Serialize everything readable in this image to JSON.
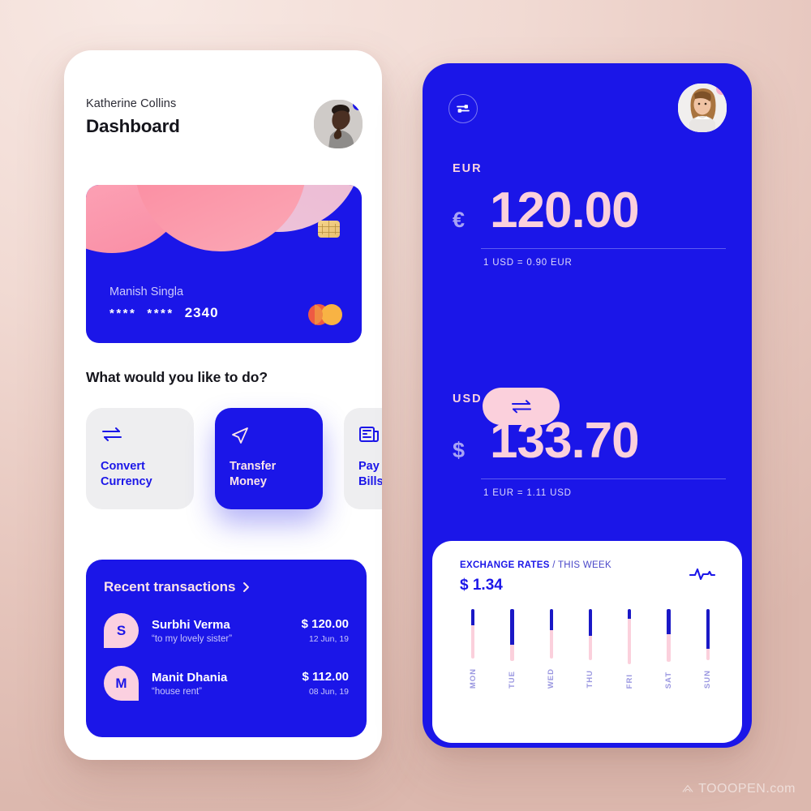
{
  "background": {
    "color_top": "#f8e9e4",
    "color_bottom": "#dcb8ae"
  },
  "brand": {
    "blue": "#1b16e8",
    "pink": "#fbd0dc",
    "light_pink": "#fbd0e0",
    "gold": "#f0c877"
  },
  "left_screen": {
    "header": {
      "user_name": "Katherine Collins",
      "title": "Dashboard",
      "avatar_icon": "user-avatar",
      "notification_dot": "blue"
    },
    "credit_card": {
      "holder": "Manish Singla",
      "mask_group_1": "****",
      "mask_group_2": "****",
      "last_four": "2340",
      "chip_icon": "emv-chip-icon",
      "network_icon": "mastercard-logo"
    },
    "prompt": "What would you like to do?",
    "actions": [
      {
        "label_line1": "Convert",
        "label_line2": "Currency",
        "icon": "swap-horizontal-icon",
        "active": false
      },
      {
        "label_line1": "Transfer",
        "label_line2": "Money",
        "icon": "send-paper-plane-icon",
        "active": true
      },
      {
        "label_line1": "Pay",
        "label_line2": "Bills",
        "icon": "bill-receipt-icon",
        "active": false
      }
    ],
    "transactions": {
      "heading": "Recent transactions",
      "chevron_icon": "chevron-right-icon",
      "items": [
        {
          "initial": "S",
          "name": "Surbhi Verma",
          "note": "“to my lovely sister”",
          "amount": "$ 120.00",
          "date": "12 Jun, 19"
        },
        {
          "initial": "M",
          "name": "Manit Dhania",
          "note": "“house rent”",
          "amount": "$ 112.00",
          "date": "08 Jun, 19"
        }
      ]
    }
  },
  "right_screen": {
    "settings_icon": "sliders-settings-icon",
    "avatar_icon": "user-avatar",
    "notification_dot": "pink",
    "from": {
      "code": "EUR",
      "symbol": "€",
      "amount": "120.00",
      "rate": "1 USD = 0.90 EUR"
    },
    "to": {
      "code": "USD",
      "symbol": "$",
      "amount": "133.70",
      "rate": "1 EUR = 1.11 USD"
    },
    "swap_button_icon": "swap-horizontal-icon",
    "chart_card": {
      "title_bold": "EXCHANGE RATES",
      "title_light": "/ THIS WEEK",
      "value": "$ 1.34",
      "trend_icon": "pulse-activity-icon"
    }
  },
  "chart_data": {
    "type": "bar",
    "title": "EXCHANGE RATES / THIS WEEK",
    "subtitle": "$ 1.34",
    "categories": [
      "MON",
      "TUE",
      "WED",
      "THU",
      "FRI",
      "SAT",
      "SUN"
    ],
    "series": [
      {
        "name": "blue-segment-pct",
        "values": [
          33,
          68,
          43,
          52,
          18,
          48,
          78
        ]
      },
      {
        "name": "pink-segment-pct",
        "values": [
          67,
          32,
          57,
          48,
          82,
          52,
          22
        ]
      }
    ],
    "ylabel": "",
    "xlabel": "",
    "ylim": [
      0,
      100
    ],
    "grid": false,
    "legend": "none",
    "colors": {
      "blue-segment-pct": "#1a18c6",
      "pink-segment-pct": "#fbd0dc"
    }
  },
  "watermark": {
    "text": "TOOOPEN.com",
    "icon": "cloud-logo-icon"
  }
}
